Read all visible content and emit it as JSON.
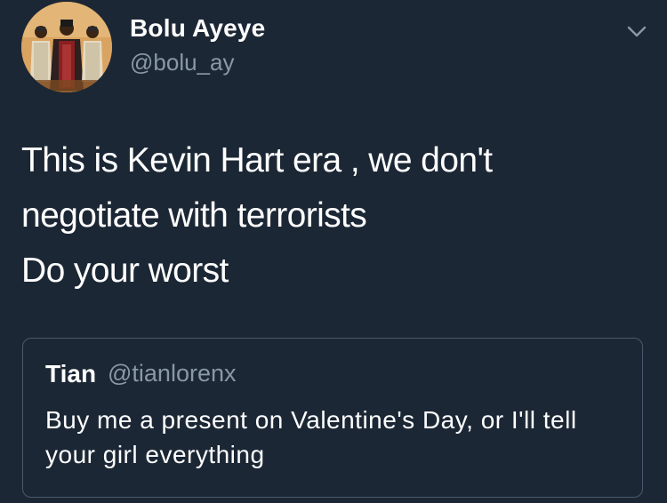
{
  "tweet": {
    "author_name": "Bolu Ayeye",
    "author_handle": "@bolu_ay",
    "text_lines": [
      "This is Kevin Hart era , we don't",
      "negotiate with terrorists",
      "Do your worst"
    ]
  },
  "quoted_tweet": {
    "author_name": "Tian",
    "author_handle": "@tianlorenx",
    "text_lines": [
      "Buy me a present on Valentine's Day, or I'll tell",
      "your girl everything"
    ]
  },
  "icons": {
    "menu": "chevron-down-icon",
    "avatar": "profile-avatar"
  },
  "colors": {
    "background": "#1c2735",
    "primary_text": "#ffffff",
    "secondary_text": "#8899a6",
    "quote_border": "#4a5a6c"
  }
}
